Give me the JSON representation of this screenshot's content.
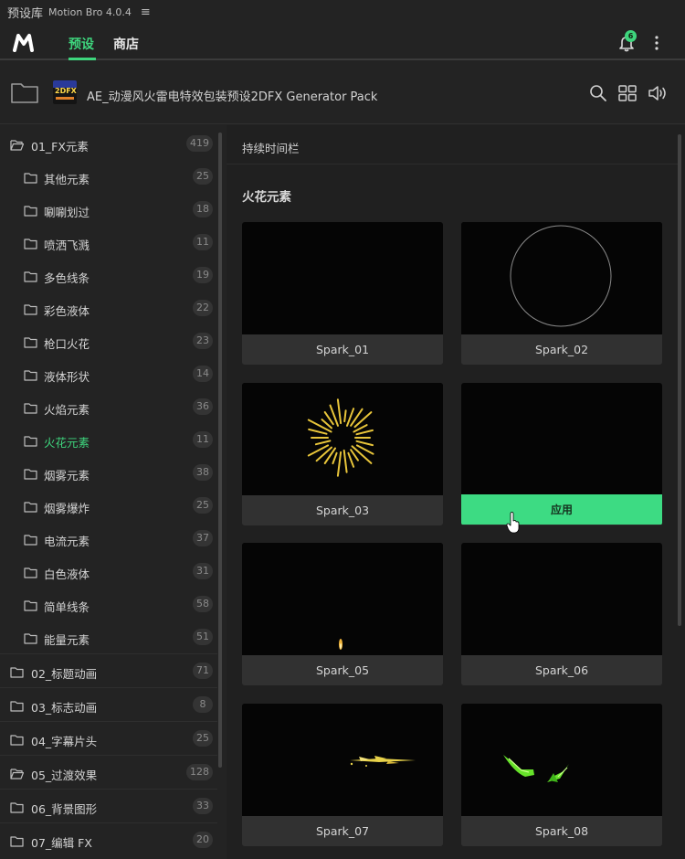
{
  "titlebar": {
    "name": "预设库",
    "app": "Motion Bro 4.0.4",
    "menu_icon": "≡"
  },
  "nav": {
    "tabs": [
      "预设",
      "商店"
    ],
    "active_tab": "预设",
    "notifications": "6",
    "accent": "#3ed57d"
  },
  "pack": {
    "thumb_text": "2DFX",
    "title": "AE_动漫风火雷电特效包装预设2DFX Generator Pack"
  },
  "sidebar": {
    "items": [
      {
        "label": "01_FX元素",
        "count": "419"
      },
      {
        "label": "其他元素",
        "count": "25"
      },
      {
        "label": "唰唰划过",
        "count": "18"
      },
      {
        "label": "喷洒飞溅",
        "count": "11"
      },
      {
        "label": "多色线条",
        "count": "19"
      },
      {
        "label": "彩色液体",
        "count": "22"
      },
      {
        "label": "枪口火花",
        "count": "23"
      },
      {
        "label": "液体形状",
        "count": "14"
      },
      {
        "label": "火焰元素",
        "count": "36"
      },
      {
        "label": "火花元素",
        "count": "11"
      },
      {
        "label": "烟雾元素",
        "count": "38"
      },
      {
        "label": "烟雾爆炸",
        "count": "25"
      },
      {
        "label": "电流元素",
        "count": "37"
      },
      {
        "label": "白色液体",
        "count": "31"
      },
      {
        "label": "简单线条",
        "count": "58"
      },
      {
        "label": "能量元素",
        "count": "51"
      },
      {
        "label": "02_标题动画",
        "count": "71"
      },
      {
        "label": "03_标志动画",
        "count": "8"
      },
      {
        "label": "04_字幕片头",
        "count": "25"
      },
      {
        "label": "05_过渡效果",
        "count": "128"
      },
      {
        "label": "06_背景图形",
        "count": "33"
      },
      {
        "label": "07_编辑 FX",
        "count": "20"
      }
    ],
    "active_item": "火花元素"
  },
  "main": {
    "sub_title": "持续时间栏",
    "section_title": "火花元素",
    "apply_label": "应用",
    "cards": [
      {
        "label": "Spark_01"
      },
      {
        "label": "Spark_02"
      },
      {
        "label": "Spark_03"
      },
      {
        "label": ""
      },
      {
        "label": "Spark_05"
      },
      {
        "label": "Spark_06"
      },
      {
        "label": "Spark_07"
      },
      {
        "label": "Spark_08"
      }
    ]
  }
}
